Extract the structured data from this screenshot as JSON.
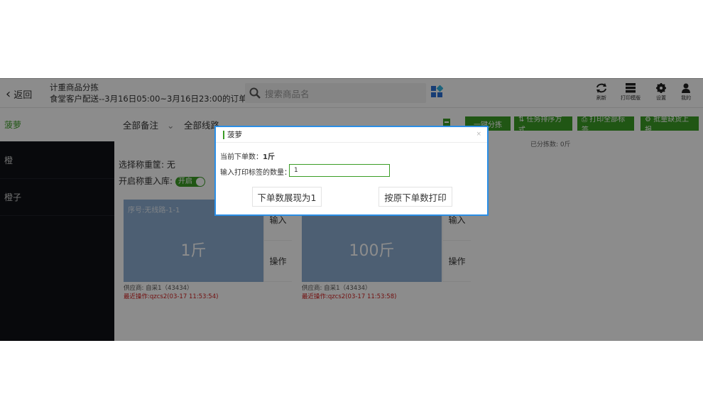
{
  "header": {
    "back_label": "返回",
    "title": "计重商品分拣",
    "subtitle": "食堂客户配送--3月16日05:00~3月16日23:00的订单",
    "search_placeholder": "搜索商品名",
    "tools": [
      {
        "label": "刷新",
        "icon": "refresh-icon"
      },
      {
        "label": "打印模版",
        "icon": "print-template-icon"
      },
      {
        "label": "设置",
        "icon": "gear-icon"
      },
      {
        "label": "我的",
        "icon": "user-icon"
      }
    ]
  },
  "sidebar": {
    "items": [
      {
        "label": "菠萝"
      },
      {
        "label": "橙"
      },
      {
        "label": "橙子"
      }
    ]
  },
  "main": {
    "filters": {
      "remark": "全部备注",
      "route": "全部线路"
    },
    "buttons": [
      {
        "label": "一键分拣"
      },
      {
        "label": "⇅ 任务排序方式"
      },
      {
        "label": "⎙ 打印全部标签"
      },
      {
        "label": "⚙ 批量缺货上报"
      }
    ],
    "sorted_weight": "已分拣数: 0斤",
    "basket_label": "选择称重筐: 无",
    "storage_label": "开启称重入库:",
    "toggle_label": "开启",
    "cards": [
      {
        "seq": "序号:无线路-1-1",
        "weight": "1斤",
        "input_label": "输入",
        "action_label": "操作",
        "supplier": "供应商: 自采1（43434）",
        "last_op": "最近操作:qzcs2(03-17 11:53:54)"
      },
      {
        "seq": "",
        "weight": "100斤",
        "input_label": "输入",
        "action_label": "操作",
        "supplier": "供应商: 自采1（43434）",
        "last_op": "最近操作:qzcs2(03-17 11:53:58)"
      }
    ]
  },
  "dialog": {
    "title": "菠萝",
    "order_qty_label": "当前下单数：",
    "order_qty_value": "1斤",
    "print_qty_label": "输入打印标签的数量：",
    "print_qty_value": "1",
    "btn_show": "下单数展现为1",
    "btn_print": "按原下单数打印",
    "close": "×"
  },
  "colors": {
    "brand_green": "#3b9d26",
    "dialog_border": "#2a8ee6",
    "card_blue": "#8caed2"
  }
}
